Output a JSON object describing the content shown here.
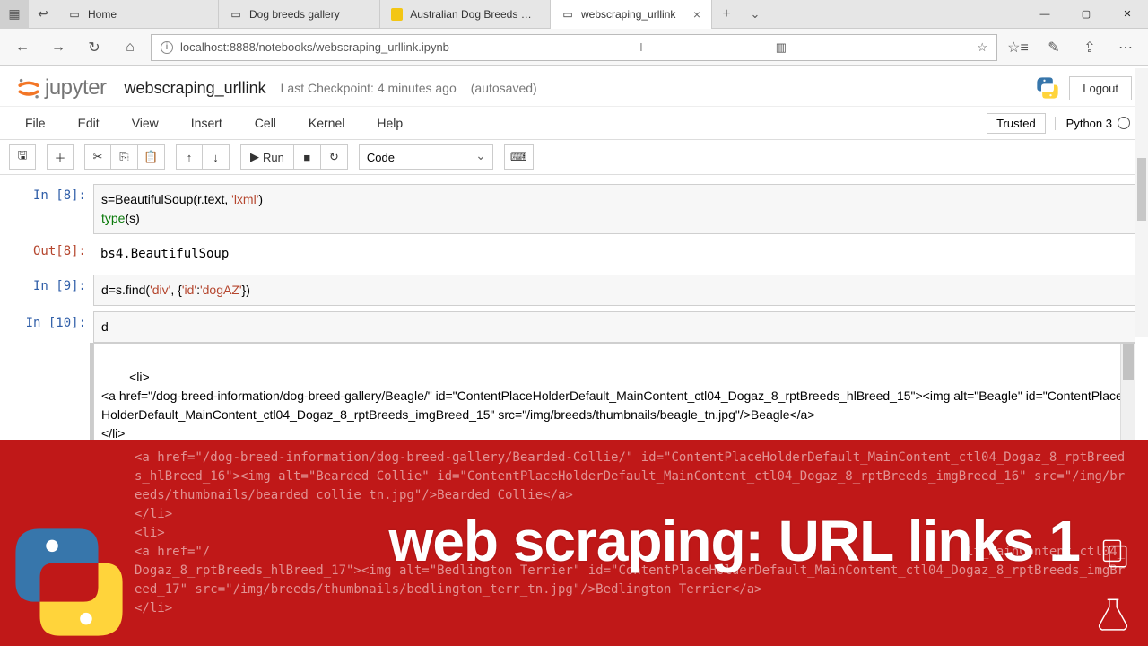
{
  "tabs": [
    {
      "label": "Home"
    },
    {
      "label": "Dog breeds gallery"
    },
    {
      "label": "Australian Dog Breeds Galle"
    },
    {
      "label": "webscraping_urllink"
    }
  ],
  "url": "localhost:8888/notebooks/webscraping_urllink.ipynb",
  "jupyter": {
    "title": "webscraping_urllink",
    "checkpoint": "Last Checkpoint: 4 minutes ago",
    "autosave": "(autosaved)",
    "logout": "Logout",
    "trusted": "Trusted",
    "kernel": "Python 3"
  },
  "menus": [
    "File",
    "Edit",
    "View",
    "Insert",
    "Cell",
    "Kernel",
    "Help"
  ],
  "toolbar": {
    "run": "Run",
    "celltype": "Code"
  },
  "cells": {
    "in8": "In [8]:",
    "in8_code_l1a": "s=BeautifulSoup(r.text, ",
    "in8_code_l1b": "'lxml'",
    "in8_code_l1c": ")",
    "in8_code_l2a": "type",
    "in8_code_l2b": "(s)",
    "out8": "Out[8]:",
    "out8_text": "bs4.BeautifulSoup",
    "in9": "In [9]:",
    "in9_code_a": "d=s.find(",
    "in9_code_b": "'div'",
    "in9_code_c": ", {",
    "in9_code_d": "'id'",
    "in9_code_e": ":",
    "in9_code_f": "'dogAZ'",
    "in9_code_g": "})",
    "in10": "In [10]:",
    "in10_code": "d",
    "out10_text": "<li>\n<a href=\"/dog-breed-information/dog-breed-gallery/Beagle/\" id=\"ContentPlaceHolderDefault_MainContent_ctl04_Dogaz_8_rptBreeds_hlBreed_15\"><img alt=\"Beagle\" id=\"ContentPlaceHolderDefault_MainContent_ctl04_Dogaz_8_rptBreeds_imgBreed_15\" src=\"/img/breeds/thumbnails/beagle_tn.jpg\"/>Beagle</a>\n</li>\n<li>"
  },
  "banner": {
    "title": "web scraping: URL links 1",
    "overflow": "<a href=\"/dog-breed-information/dog-breed-gallery/Bearded-Collie/\" id=\"ContentPlaceHolderDefault_MainContent_ctl04_Dogaz_8_rptBreeds_hlBreed_16\"><img alt=\"Bearded Collie\" id=\"ContentPlaceHolderDefault_MainContent_ctl04_Dogaz_8_rptBreeds_imgBreed_16\" src=\"/img/breeds/thumbnails/bearded_collie_tn.jpg\"/>Bearded Collie</a>\n</li>\n<li>\n<a href=\"/                                                                                                    lt_MainContent_ctl04_Dogaz_8_rptBreeds_hlBreed_17\"><img alt=\"Bedlington Terrier\" id=\"ContentPlaceHolderDefault_MainContent_ctl04_Dogaz_8_rptBreeds_imgBreed_17\" src=\"/img/breeds/thumbnails/bedlington_terr_tn.jpg\"/>Bedlington Terrier</a>\n</li>"
  }
}
